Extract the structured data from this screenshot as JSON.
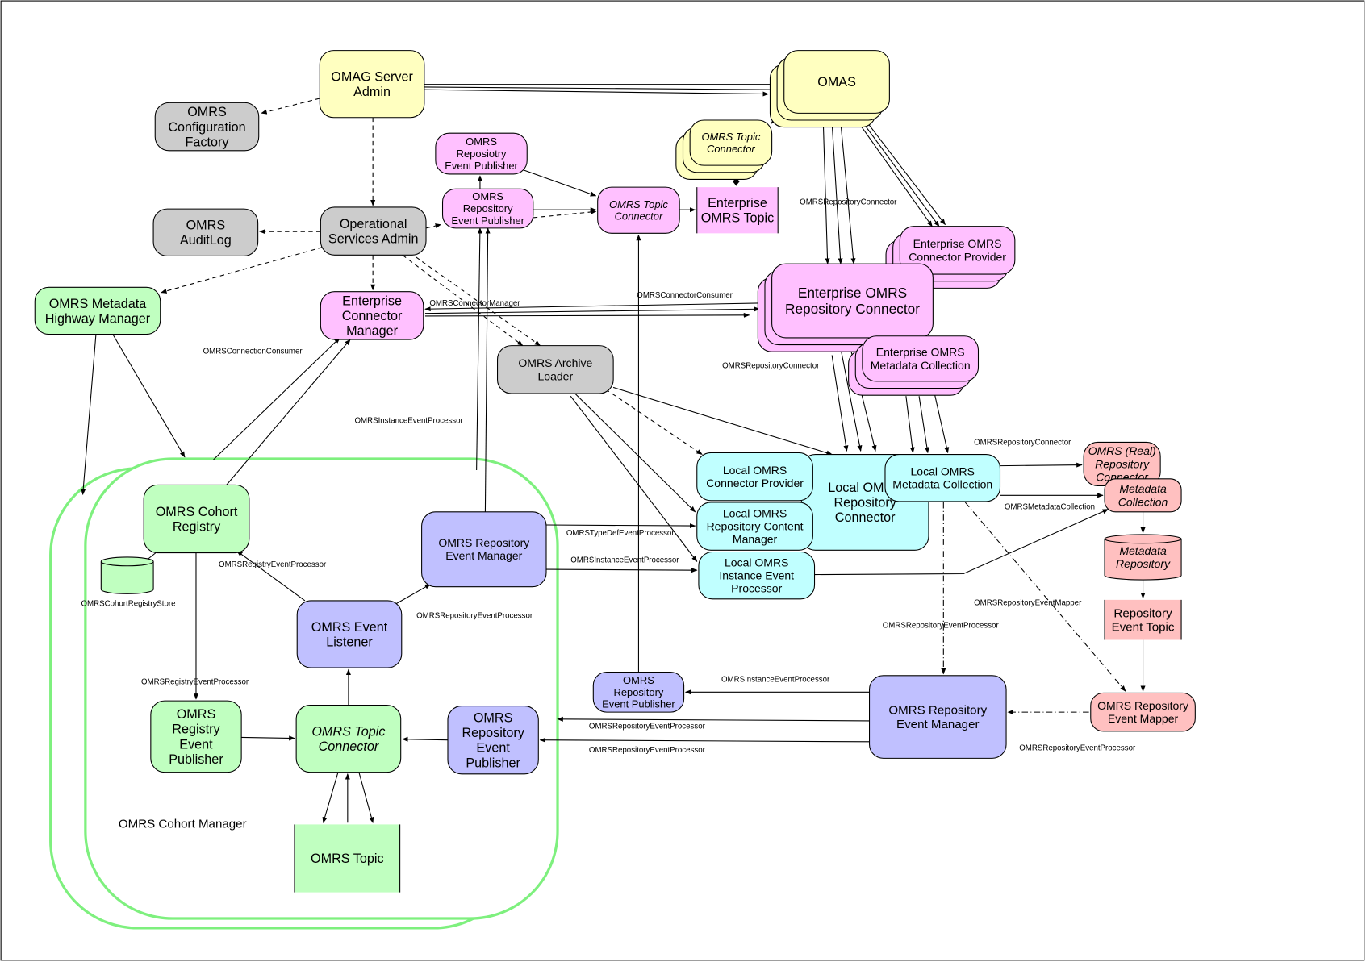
{
  "colors": {
    "admin_yellow": "#ffffc0",
    "service_gray": "#cccccc",
    "enterprise_pink": "#ffc0ff",
    "cohort_green": "#c0ffc0",
    "local_cyan": "#c0ffff",
    "event_purple": "#c0c0ff",
    "repository_salmon": "#ffc0c0",
    "cohort_outline": "#7ef07e"
  },
  "nodes": {
    "omag": [
      "OMAG Server",
      "Admin"
    ],
    "config": [
      "OMRS",
      "Configuration",
      "Factory"
    ],
    "omas": [
      "OMAS"
    ],
    "ytopicconn": [
      "OMRS Topic",
      "Connector"
    ],
    "enttopic": [
      "Enterprise",
      "OMRS Topic"
    ],
    "pubtop": [
      "OMRS",
      "Reposiotry",
      "Event Publisher"
    ],
    "pub2": [
      "OMRS",
      "Repository",
      "Event Publisher"
    ],
    "ptopicconn": [
      "OMRS Topic",
      "Connector"
    ],
    "auditlog": [
      "OMRS",
      "AuditLog"
    ],
    "opservices": [
      "Operational",
      "Services Admin"
    ],
    "entprovider": [
      "Enterprise OMRS",
      "Connector Provider"
    ],
    "highway": [
      "OMRS Metadata",
      "Highway Manager"
    ],
    "entconnmgr": [
      "Enterprise",
      "Connector",
      "Manager"
    ],
    "entrepoconn": [
      "Enterprise OMRS",
      "Repository Connector"
    ],
    "archive": [
      "OMRS Archive",
      "Loader"
    ],
    "entmdcoll": [
      "Enterprise OMRS",
      "Metadata Collection"
    ],
    "localrepoconn": [
      "Local OMRS",
      "Repository",
      "Connector"
    ],
    "localprovider": [
      "Local OMRS",
      "Connector Provider"
    ],
    "contentmgr": [
      "Local OMRS",
      "Repository Content",
      "Manager"
    ],
    "instproc": [
      "Local OMRS",
      "Instance Event",
      "Processor"
    ],
    "localmd": [
      "Local OMRS",
      "Metadata Collection"
    ],
    "realconn": [
      "OMRS (Real)",
      "Repository",
      "Connector"
    ],
    "mdcoll": [
      "Metadata",
      "Collection"
    ],
    "mdrepo": [
      "Metadata",
      "Repository"
    ],
    "repotopic": [
      "Repository",
      "Event Topic"
    ],
    "mapper": [
      "OMRS Repository",
      "Event Mapper"
    ],
    "cohortreg": [
      "OMRS Cohort",
      "Registry"
    ],
    "store": [],
    "leftmgr": [
      "OMRS Repository",
      "Event Manager"
    ],
    "listener": [
      "OMRS Event",
      "Listener"
    ],
    "regpub": [
      "OMRS",
      "Registry",
      "Event",
      "Publisher"
    ],
    "gtopicconn": [
      "OMRS Topic",
      "Connector"
    ],
    "purplepub": [
      "OMRS",
      "Repository",
      "Event",
      "Publisher"
    ],
    "omrstopic": [
      "OMRS Topic"
    ],
    "smallpub": [
      "OMRS",
      "Repository",
      "Event Publisher"
    ],
    "rightmgr": [
      "OMRS Repository",
      "Event Manager"
    ]
  },
  "cohort_manager_label": "OMRS Cohort Manager",
  "edge_labels": [
    "OMRSRepositoryConnector",
    "OMRSConnectorConsumer",
    "OMRSConnectorManager",
    "OMRSConnectionConsumer",
    "OMRSRepositoryConnector",
    "OMRSInstanceEventProcessor",
    "OMRSRepositoryConnector",
    "OMRSMetadataCollection",
    "OMRSTypeDefEventProcessor",
    "OMRSInstanceEventProcessor",
    "OMRSRegistryEventProcessor",
    "OMRSCohortRegistryStore",
    "OMRSRepositoryEventMapper",
    "OMRSRepositoryEventProcessor",
    "OMRSRepositoryEventProcessor",
    "OMRSInstanceEventProcessor",
    "OMRSRegistryEventProcessor",
    "OMRSRepositoryEventProcessor",
    "OMRSRepositoryEventProcessor",
    "OMRSRepositoryEventProcessor"
  ]
}
